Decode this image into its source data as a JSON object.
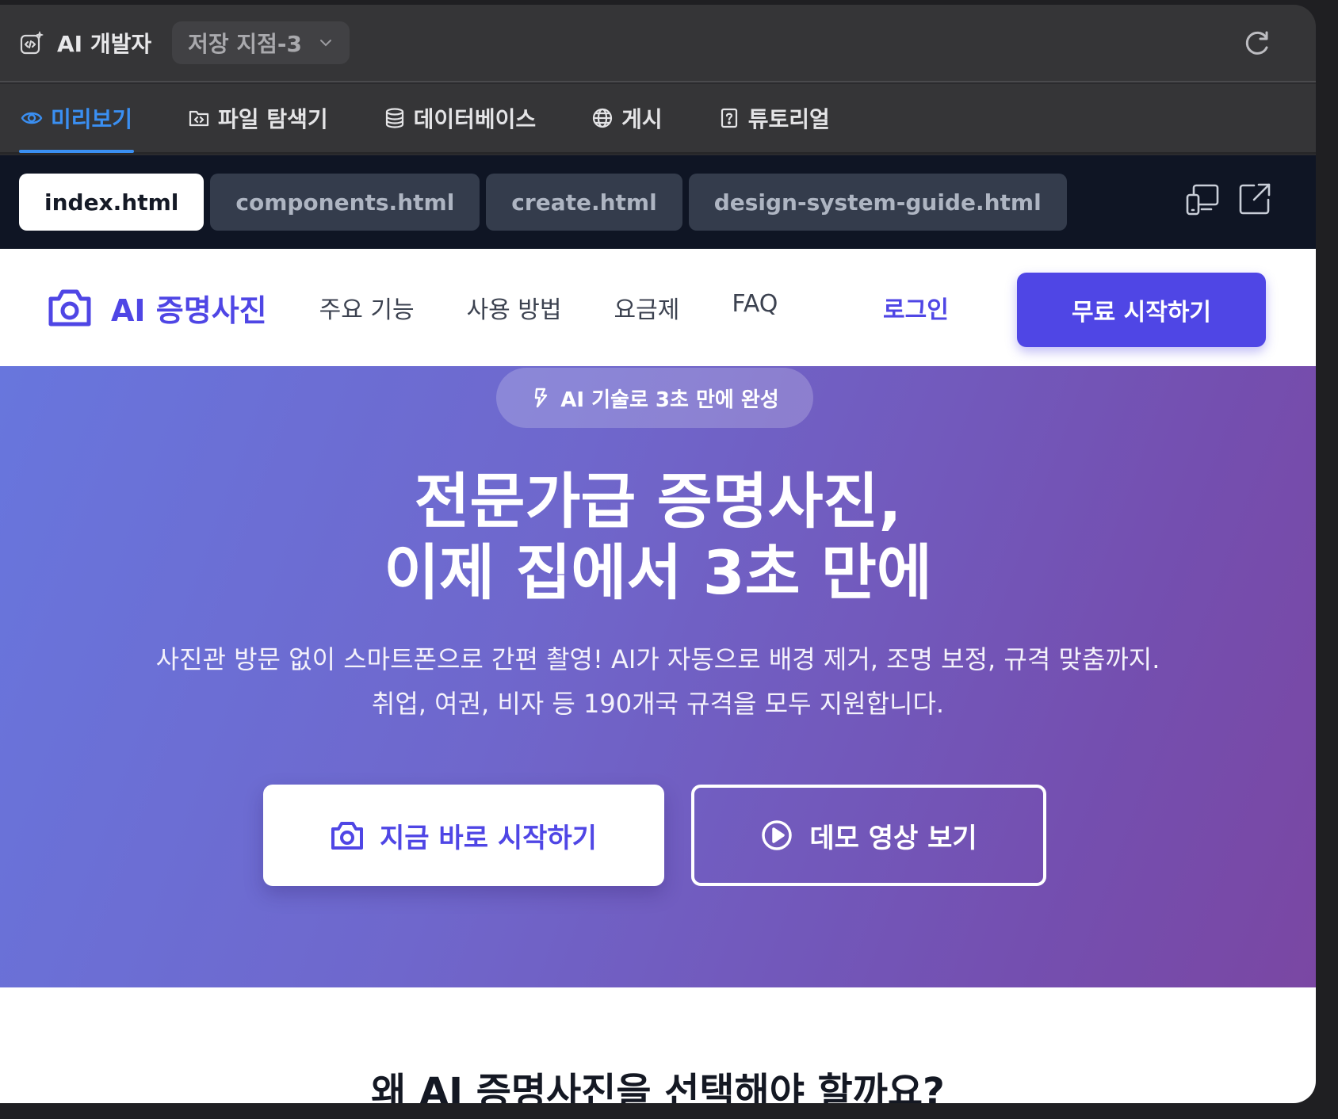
{
  "app": {
    "title": "AI 개발자",
    "branch": "저장 지점-3"
  },
  "tabs": [
    {
      "label": "미리보기"
    },
    {
      "label": "파일 탐색기"
    },
    {
      "label": "데이터베이스"
    },
    {
      "label": "게시"
    },
    {
      "label": "튜토리얼"
    }
  ],
  "files": [
    {
      "label": "index.html"
    },
    {
      "label": "components.html"
    },
    {
      "label": "create.html"
    },
    {
      "label": "design-system-guide.html"
    }
  ],
  "site": {
    "brand": "AI 증명사진",
    "nav": [
      "주요 기능",
      "사용 방법",
      "요금제",
      "FAQ"
    ],
    "login": "로그인",
    "cta": "무료 시작하기",
    "badge": "AI 기술로 3초 만에 완성",
    "title_line1": "전문가급 증명사진,",
    "title_line2": "이제 집에서 3초 만에",
    "subtitle_line1": "사진관 방문 없이 스마트폰으로 간편 촬영! AI가 자동으로 배경 제거, 조명 보정, 규격 맞춤까지.",
    "subtitle_line2": "취업, 여권, 비자 등 190개국 규격을 모두 지원합니다.",
    "primary_button": "지금 바로 시작하기",
    "secondary_button": "데모 영상 보기",
    "section_title": "왜 AI 증명사진을 선택해야 할까요?"
  },
  "colors": {
    "accent": "#3a8ff2",
    "brand": "#4f46e5",
    "hero_start": "#6876dd",
    "hero_end": "#7a47a3"
  },
  "icons": [
    "code-sparkle-icon",
    "chevron-down-icon",
    "refresh-icon",
    "eye-icon",
    "folder-code-icon",
    "database-icon",
    "globe-icon",
    "help-icon",
    "devices-icon",
    "external-link-icon",
    "camera-icon",
    "lightning-icon",
    "play-circle-icon"
  ]
}
